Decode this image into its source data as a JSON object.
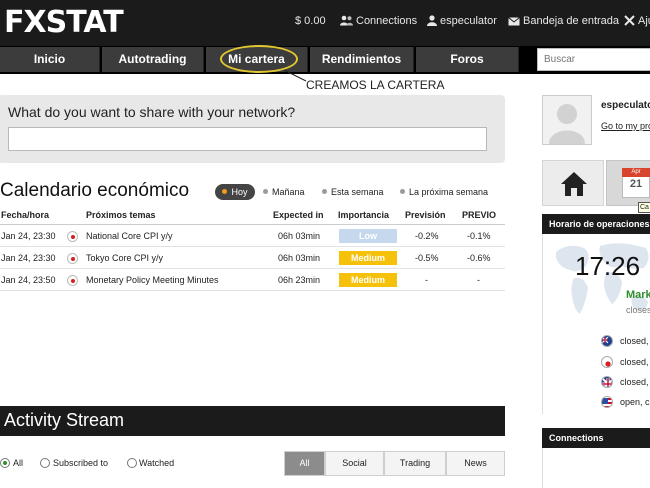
{
  "header": {
    "logo": "FXSTAT",
    "balance": "$ 0.00",
    "connections": "Connections",
    "username": "especulator",
    "inbox": "Bandeja de entrada",
    "settings": "Aju"
  },
  "nav": {
    "items": [
      "Inicio",
      "Autotrading",
      "Mi cartera",
      "Rendimientos",
      "Foros"
    ],
    "search_placeholder": "Buscar"
  },
  "annotation": "CREAMOS LA CARTERA",
  "share": {
    "title": "What do you want to share with your network?",
    "value": ""
  },
  "calendar": {
    "title": "Calendario económico",
    "filters": [
      "Hoy",
      "Mañana",
      "Esta semana",
      "La próxima semana"
    ],
    "active_filter": "Hoy",
    "columns": [
      "Fecha/hora",
      "Próximos temas",
      "Expected in",
      "Importancia",
      "Previsión",
      "PREVIO"
    ],
    "rows": [
      {
        "date": "Jan 24, 23:30",
        "topic": "National Core CPI y/y",
        "expected": "06h 03min",
        "importance": "Low",
        "forecast": "-0.2%",
        "previous": "-0.1%"
      },
      {
        "date": "Jan 24, 23:30",
        "topic": "Tokyo Core CPI y/y",
        "expected": "06h 03min",
        "importance": "Medium",
        "forecast": "-0.5%",
        "previous": "-0.6%"
      },
      {
        "date": "Jan 24, 23:50",
        "topic": "Monetary Policy Meeting Minutes",
        "expected": "06h 23min",
        "importance": "Medium",
        "forecast": "-",
        "previous": "-"
      }
    ]
  },
  "activity": {
    "title": "Activity Stream",
    "radios": [
      "All",
      "Subscribed to",
      "Watched"
    ],
    "active_radio": "All",
    "tabs": [
      "All",
      "Social",
      "Trading",
      "News"
    ],
    "active_tab": "All"
  },
  "sidebar": {
    "username": "especulato",
    "link": "Go to my pro",
    "calendar_month": "Apr",
    "calendar_day": "21",
    "calendar_tooltip": "Ca",
    "hours_title": "Horario de operaciones",
    "clock": "17:26",
    "market_status": "Mark",
    "market_sub": "closes",
    "markets": [
      {
        "flag": "au",
        "status": "closed,"
      },
      {
        "flag": "jp",
        "status": "closed,"
      },
      {
        "flag": "gb",
        "status": "closed,"
      },
      {
        "flag": "us",
        "status": "open, c"
      }
    ],
    "connections_title": "Connections"
  },
  "colors": {
    "topbar": "#1b1b1b",
    "nav_button": "#3c3c3c",
    "highlight_ellipse": "#e3c72e",
    "importance_low": "#c6d8ee",
    "importance_medium": "#f6c10a",
    "market_open": "#2f8f2f"
  }
}
